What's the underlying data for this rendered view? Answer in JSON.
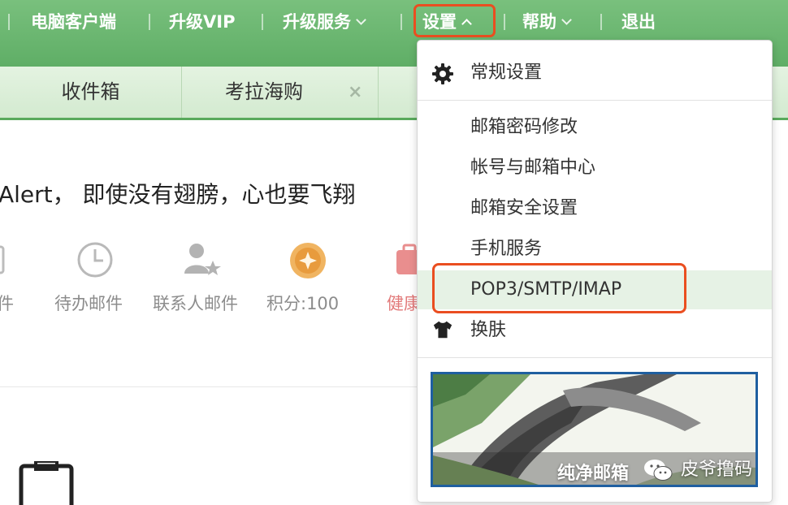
{
  "topnav": {
    "client": "电脑客户端",
    "vip": "升级VIP",
    "services": "升级服务",
    "settings": "设置",
    "help": "帮助",
    "logout": "退出"
  },
  "tabs": [
    {
      "label": "收件箱"
    },
    {
      "label": "考拉海购",
      "close": "×"
    }
  ],
  "main": {
    "slogan": "Alert， 即使没有翅膀，心也要飞翔",
    "quick_links": [
      {
        "label": "件",
        "icon": "mail-icon"
      },
      {
        "label": "待办邮件",
        "icon": "clock-icon"
      },
      {
        "label": "联系人邮件",
        "icon": "contact-star-icon"
      },
      {
        "label": "积分:100",
        "icon": "points-coin-icon"
      },
      {
        "label": "健康",
        "icon": "health-kit-icon"
      }
    ]
  },
  "settings_menu": {
    "general": {
      "label": "常规设置",
      "icon": "gear-icon"
    },
    "items": [
      {
        "label": "邮箱密码修改"
      },
      {
        "label": "帐号与邮箱中心"
      },
      {
        "label": "邮箱安全设置"
      },
      {
        "label": "手机服务"
      },
      {
        "label": "POP3/SMTP/IMAP",
        "highlighted": true
      }
    ],
    "skin": {
      "label": "换肤",
      "icon": "tshirt-icon"
    },
    "banner": {
      "caption": "纯净邮箱"
    }
  },
  "watermark": {
    "text": "皮爷撸码",
    "icon": "wechat-icon"
  },
  "colors": {
    "accent_green": "#5fae66",
    "highlight_border": "#ea4e20",
    "banner_border": "#1f5fa0"
  }
}
